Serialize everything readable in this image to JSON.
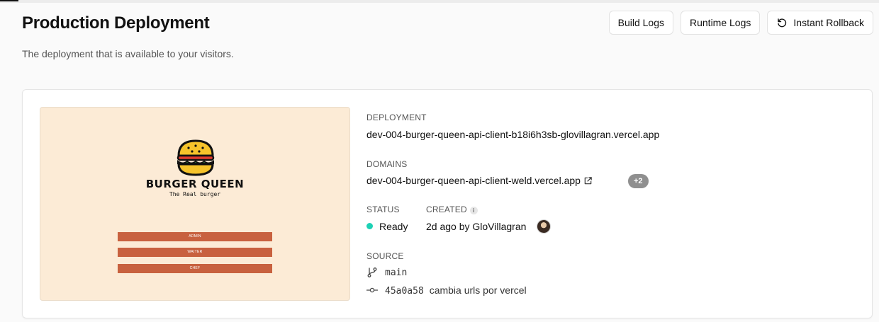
{
  "header": {
    "title": "Production Deployment",
    "subtitle": "The deployment that is available to your visitors."
  },
  "actions": {
    "build_logs": "Build Logs",
    "runtime_logs": "Runtime Logs",
    "instant_rollback": "Instant Rollback"
  },
  "preview": {
    "brand": "BURGER QUEEN",
    "tagline": "The Real burger",
    "roles": [
      "ADMIN",
      "WAITER",
      "CHEF"
    ]
  },
  "deployment": {
    "label": "DEPLOYMENT",
    "url": "dev-004-burger-queen-api-client-b18i6h3sb-glovillagran.vercel.app"
  },
  "domains": {
    "label": "DOMAINS",
    "url": "dev-004-burger-queen-api-client-weld.vercel.app",
    "extra_count": "+2"
  },
  "status": {
    "label": "STATUS",
    "value": "Ready",
    "color": "#1dd1b5"
  },
  "created": {
    "label": "CREATED",
    "info_icon": "i",
    "value": "2d ago by GloVillagran"
  },
  "source": {
    "label": "SOURCE",
    "branch": "main",
    "commit_hash": "45a0a58",
    "commit_message": "cambia urls por vercel"
  }
}
